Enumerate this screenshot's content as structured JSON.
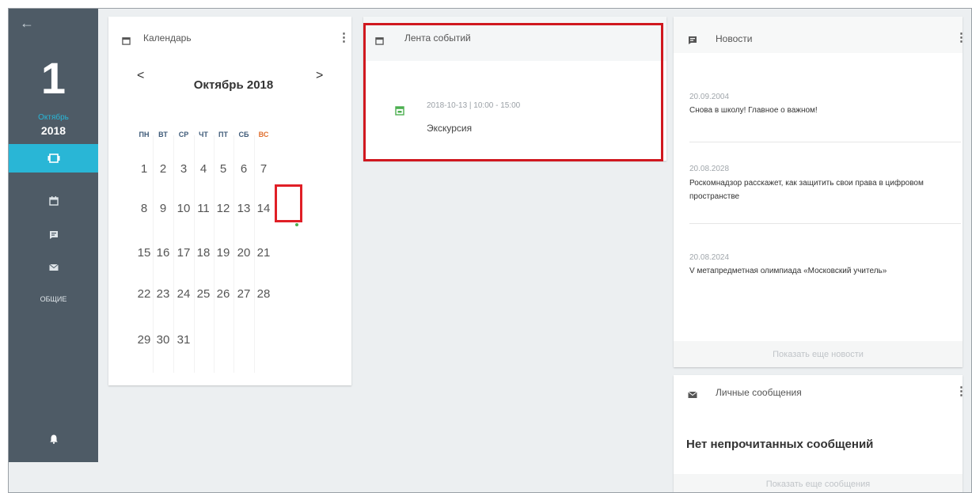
{
  "sidebar": {
    "back_icon": "arrow-left-icon",
    "day": "1",
    "month": "Октябрь",
    "year": "2018",
    "items": [
      {
        "icon": "cards-icon",
        "active": true
      },
      {
        "icon": "calendar-icon",
        "active": false
      },
      {
        "icon": "news-icon",
        "active": false
      },
      {
        "icon": "mail-icon",
        "active": false
      }
    ],
    "general_label": "ОБЩИЕ",
    "bell_icon": "bell-icon",
    "accent": "#29b6d6",
    "background": "#4e5b66"
  },
  "calendar": {
    "title": "Календарь",
    "month_label": "Октябрь 2018",
    "weekdays": [
      "ПН",
      "ВТ",
      "СР",
      "ЧТ",
      "ПТ",
      "СБ",
      "ВС"
    ],
    "weekday_colors": [
      "#3f5b79",
      "#3f5b79",
      "#3f5b79",
      "#3f5b79",
      "#3f5b79",
      "#3f5b79",
      "#e07030"
    ],
    "weeks": [
      [
        "1",
        "2",
        "3",
        "4",
        "5",
        "6",
        "7"
      ],
      [
        "8",
        "9",
        "10",
        "11",
        "12",
        "13",
        "14"
      ],
      [
        "15",
        "16",
        "17",
        "18",
        "19",
        "20",
        "21"
      ],
      [
        "22",
        "23",
        "24",
        "25",
        "26",
        "27",
        "28"
      ],
      [
        "29",
        "30",
        "31"
      ]
    ],
    "highlighted_day": "13",
    "highlight_color": "#e01f26"
  },
  "events": {
    "title": "Лента событий",
    "items": [
      {
        "datetime": "2018-10-13 | 10:00 - 15:00",
        "name": "Экскурсия"
      }
    ],
    "highlight_color": "#d0181f"
  },
  "news": {
    "title": "Новости",
    "items": [
      {
        "date": "20.09.2004",
        "text": "Снова в школу! Главное о важном!"
      },
      {
        "date": "20.08.2028",
        "text": "Роскомнадзор расскажет, как защитить свои права в цифровом пространстве"
      },
      {
        "date": "20.08.2024",
        "text": "V метапредметная олимпиада «Московский учитель»"
      }
    ],
    "more_label": "Показать еще новости"
  },
  "messages": {
    "title": "Личные сообщения",
    "empty_text": "Нет непрочитанных сообщений",
    "more_label": "Показать еще сообщения"
  }
}
